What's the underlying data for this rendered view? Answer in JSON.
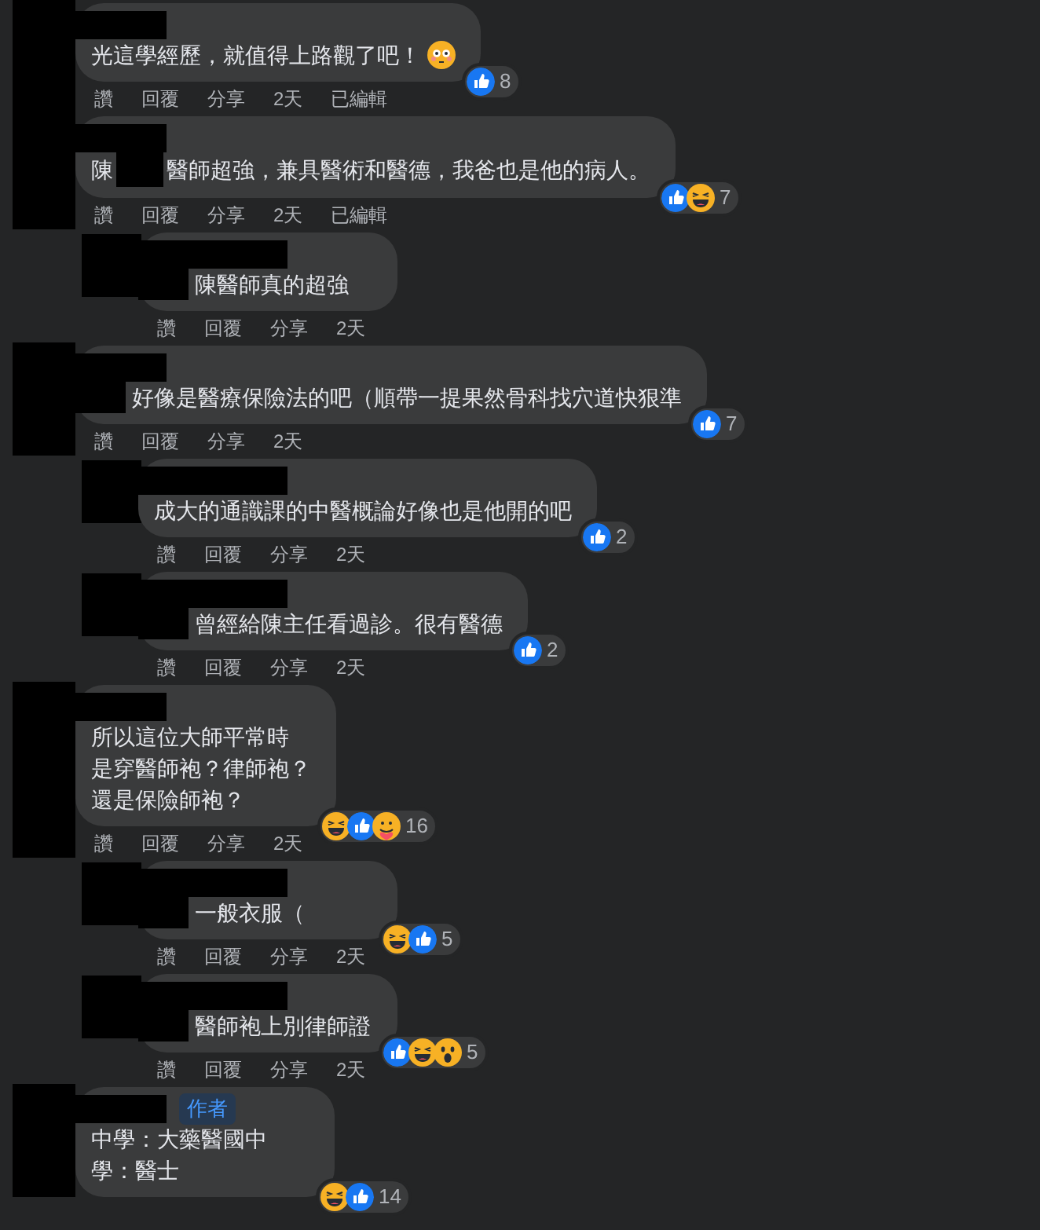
{
  "comments": [
    {
      "reply": false,
      "lines": [
        [
          {
            "kind": "text",
            "text": "光這學經歷，就值得上路觀了吧！"
          },
          {
            "kind": "flushed_emoji"
          }
        ]
      ],
      "reactions": [
        {
          "kind": "like"
        }
      ],
      "count": "8",
      "actions": [
        "讚",
        "回覆",
        "分享",
        "2天",
        "已編輯"
      ]
    },
    {
      "reply": false,
      "lines": [
        [
          {
            "kind": "text",
            "text": "陳"
          },
          {
            "kind": "hidden"
          },
          {
            "kind": "text",
            "text": "醫師超強，兼具醫術和醫德，我爸也是他的病人。"
          }
        ]
      ],
      "reactions": [
        {
          "kind": "like"
        },
        {
          "kind": "haha"
        }
      ],
      "count": "7",
      "actions": [
        "讚",
        "回覆",
        "分享",
        "2天",
        "已編輯"
      ]
    },
    {
      "reply": true,
      "lines": [
        [
          {
            "kind": "hidden"
          },
          {
            "kind": "text",
            "text": "陳醫師真的超強"
          }
        ]
      ],
      "actions": [
        "讚",
        "回覆",
        "分享",
        "2天"
      ]
    },
    {
      "reply": false,
      "lines": [
        [
          {
            "kind": "hidden"
          },
          {
            "kind": "text",
            "text": "好像是醫療保險法的吧（順帶一提果然骨科找穴道快狠準"
          }
        ]
      ],
      "reactions": [
        {
          "kind": "like"
        }
      ],
      "count": "7",
      "actions": [
        "讚",
        "回覆",
        "分享",
        "2天"
      ]
    },
    {
      "reply": true,
      "lines": [
        [
          {
            "kind": "text",
            "text": "成大的通識課的中醫概論好像也是他開的吧"
          }
        ]
      ],
      "reactions": [
        {
          "kind": "like"
        }
      ],
      "count": "2",
      "actions": [
        "讚",
        "回覆",
        "分享",
        "2天"
      ]
    },
    {
      "reply": true,
      "lines": [
        [
          {
            "kind": "hidden"
          },
          {
            "kind": "text",
            "text": "曾經給陳主任看過診。很有醫德"
          }
        ]
      ],
      "reactions": [
        {
          "kind": "like"
        }
      ],
      "count": "2",
      "actions": [
        "讚",
        "回覆",
        "分享",
        "2天"
      ]
    },
    {
      "reply": false,
      "lines": [
        [
          {
            "kind": "text",
            "text": "所以這位大師平常時"
          }
        ],
        [
          {
            "kind": "text",
            "text": "是穿醫師袍？律師袍？"
          }
        ],
        [
          {
            "kind": "text",
            "text": "還是保險師袍？"
          }
        ]
      ],
      "reactions": [
        {
          "kind": "haha"
        },
        {
          "kind": "like"
        },
        {
          "kind": "care"
        }
      ],
      "count": "16",
      "actions": [
        "讚",
        "回覆",
        "分享",
        "2天"
      ]
    },
    {
      "reply": true,
      "lines": [
        [
          {
            "kind": "hidden"
          },
          {
            "kind": "text",
            "text": "一般衣服（"
          }
        ]
      ],
      "reactions": [
        {
          "kind": "haha"
        },
        {
          "kind": "like"
        }
      ],
      "count": "5",
      "actions": [
        "讚",
        "回覆",
        "分享",
        "2天"
      ]
    },
    {
      "reply": true,
      "lines": [
        [
          {
            "kind": "hidden"
          },
          {
            "kind": "text",
            "text": "醫師袍上別律師證"
          }
        ]
      ],
      "reactions": [
        {
          "kind": "like"
        },
        {
          "kind": "haha"
        },
        {
          "kind": "wow"
        }
      ],
      "count": "5",
      "actions": [
        "讚",
        "回覆",
        "分享",
        "2天"
      ]
    },
    {
      "reply": false,
      "lines": [
        [
          {
            "kind": "text",
            "text": "中學：大藥醫國中"
          }
        ],
        [
          {
            "kind": "text",
            "text": "學：醫士"
          }
        ]
      ],
      "reactions": [
        {
          "kind": "haha"
        },
        {
          "kind": "like"
        }
      ],
      "count": "14",
      "author_badge": "作者"
    }
  ]
}
